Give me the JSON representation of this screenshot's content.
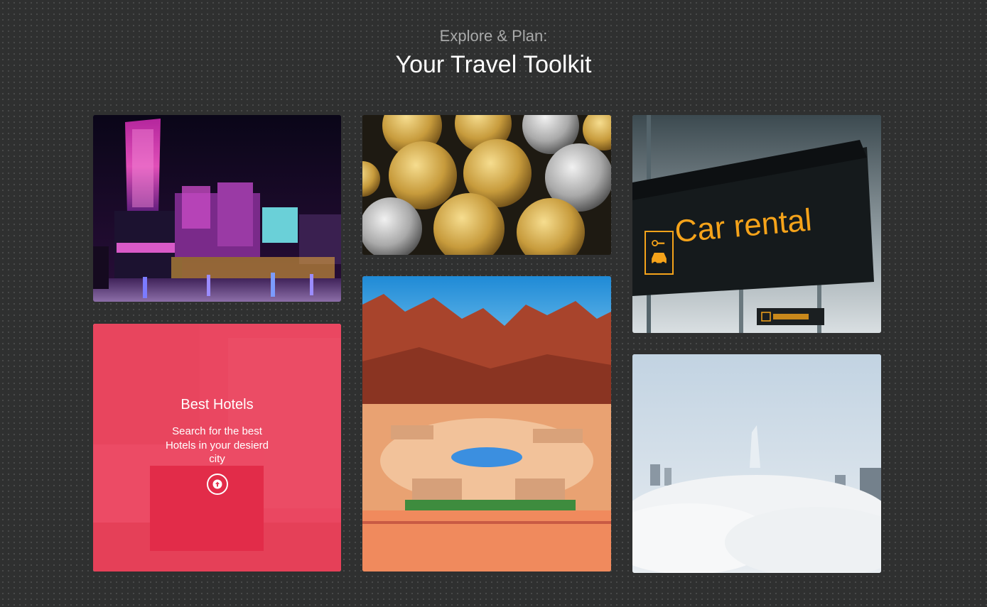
{
  "header": {
    "subtitle": "Explore & Plan:",
    "title": "Your Travel Toolkit"
  },
  "cards": {
    "hotels": {
      "title": "Best Hotels",
      "description": "Search for the best Hotels in your desierd city",
      "icon": "arrow-up-circle-icon"
    },
    "car_rental": {
      "sign_text": "Car rental"
    }
  },
  "colors": {
    "background": "#2f3030",
    "overlay_accent": "#e8334f",
    "sign_text": "#f5a31a"
  }
}
